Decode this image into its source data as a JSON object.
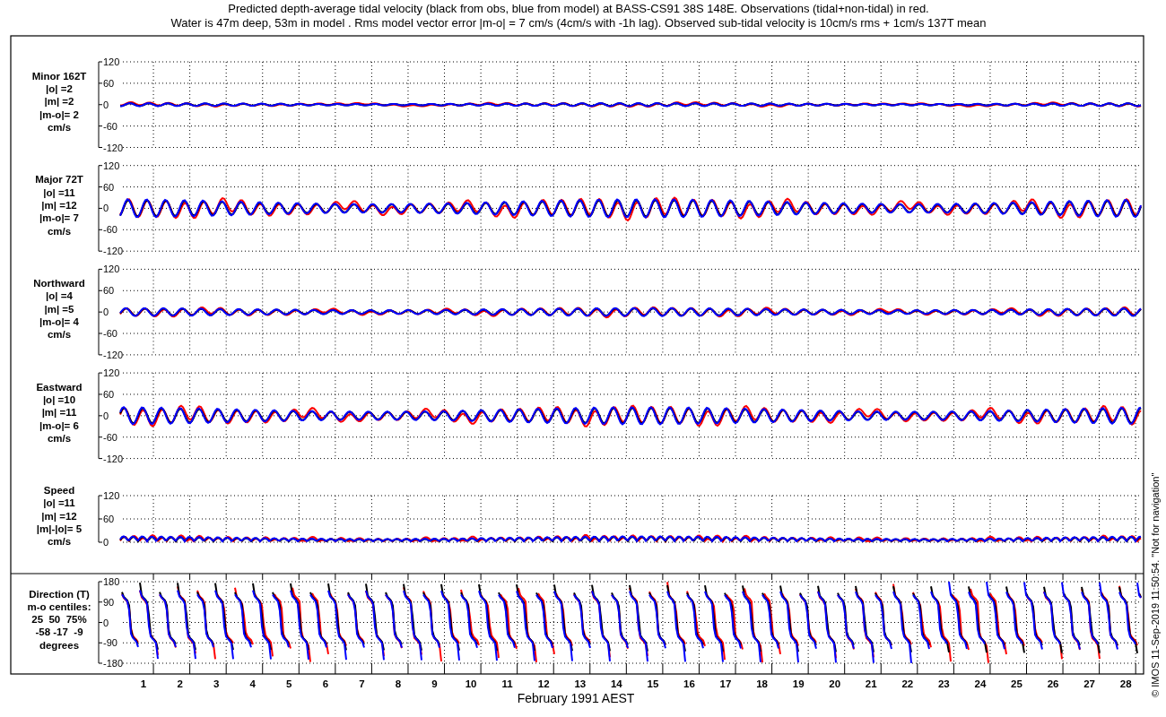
{
  "title_lines": [
    "Predicted depth-average tidal velocity (black from obs, blue from model) at BASS-CS91 38S 148E. Observations (tidal+non-tidal) in red.",
    "Water is 47m deep, 53m in model . Rms model vector error |m-o| = 7 cm/s (4cm/s with -1h lag). Observed sub-tidal velocity is 10cm/s rms + 1cm/s 137T mean"
  ],
  "panels": [
    {
      "kind": "velocity",
      "labels": [
        "Minor 162T",
        "|o| =2",
        "|m| =2",
        "|m-o|= 2",
        "cm/s"
      ],
      "yticks": [
        "120",
        "60",
        "0",
        "-60",
        "-120"
      ]
    },
    {
      "kind": "velocity",
      "labels": [
        "Major 72T",
        "|o| =11",
        "|m| =12",
        "|m-o|= 7",
        "cm/s"
      ],
      "yticks": [
        "120",
        "60",
        "0",
        "-60",
        "-120"
      ]
    },
    {
      "kind": "velocity",
      "labels": [
        "Northward",
        "|o| =4",
        "|m| =5",
        "|m-o|= 4",
        "cm/s"
      ],
      "yticks": [
        "120",
        "60",
        "0",
        "-60",
        "-120"
      ]
    },
    {
      "kind": "velocity",
      "labels": [
        "Eastward",
        "|o| =10",
        "|m| =11",
        "|m-o|= 6",
        "cm/s"
      ],
      "yticks": [
        "120",
        "60",
        "0",
        "-60",
        "-120"
      ]
    },
    {
      "kind": "speed",
      "labels": [
        "Speed",
        "|o| =11",
        "|m| =12",
        "|m|-|o|= 5",
        "cm/s"
      ],
      "yticks": [
        "120",
        "60",
        "0"
      ]
    },
    {
      "kind": "direction",
      "labels": [
        "Direction (T)",
        "m-o centiles:",
        "25  50  75%",
        "-58 -17  -9",
        "degrees"
      ],
      "yticks": [
        "180",
        "90",
        "0",
        "-90",
        "-180"
      ]
    }
  ],
  "x_axis": {
    "ticks": [
      "1",
      "2",
      "3",
      "4",
      "5",
      "6",
      "7",
      "8",
      "9",
      "10",
      "11",
      "12",
      "13",
      "14",
      "15",
      "16",
      "17",
      "18",
      "19",
      "20",
      "21",
      "22",
      "23",
      "24",
      "25",
      "26",
      "27",
      "28"
    ],
    "label": "February 1991 AEST"
  },
  "credit": "© IMOS 11-Sep-2019 11:50:54. \"Not for navigation\""
}
